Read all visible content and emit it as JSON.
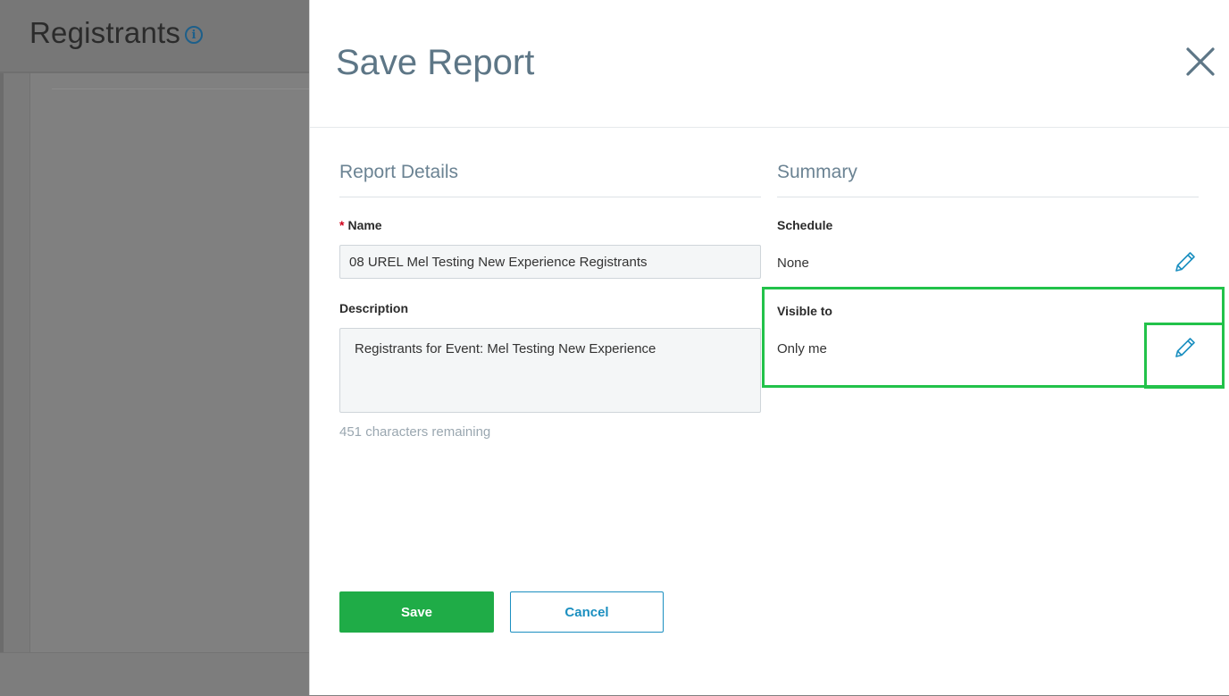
{
  "background": {
    "page_title": "Registrants",
    "info_icon_glyph": "i"
  },
  "modal": {
    "title": "Save Report",
    "details": {
      "heading": "Report Details",
      "name_required_marker": "*",
      "name_label": "Name",
      "name_value": "08 UREL Mel Testing New Experience Registrants",
      "description_label": "Description",
      "description_value": "Registrants for Event: Mel Testing New Experience",
      "chars_remaining": "451 characters remaining"
    },
    "summary": {
      "heading": "Summary",
      "schedule_label": "Schedule",
      "schedule_value": "None",
      "visible_label": "Visible to",
      "visible_value": "Only me"
    },
    "buttons": {
      "save": "Save",
      "cancel": "Cancel"
    }
  },
  "colors": {
    "accent_green": "#1fac47",
    "accent_blue": "#1b8fc0",
    "title_slate": "#5d7686",
    "highlight": "#22c24a"
  },
  "icons": [
    "info-icon",
    "close-icon",
    "pencil-icon"
  ]
}
